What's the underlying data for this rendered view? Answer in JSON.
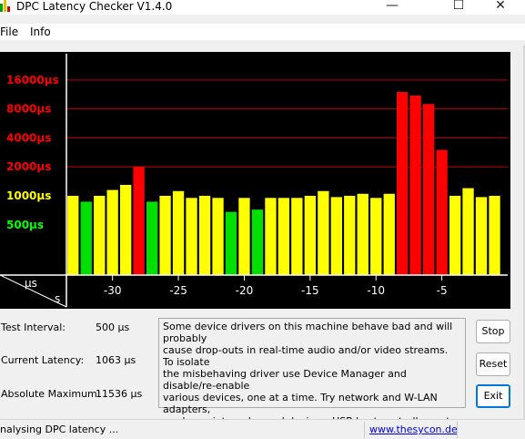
{
  "window": {
    "title": "DPC Latency Checker V1.4.0",
    "minimize_glyph": "—",
    "maximize_glyph": "☐",
    "close_glyph": "✕"
  },
  "menu": {
    "items": [
      "File",
      "Info"
    ]
  },
  "colors": {
    "chart_bg": "#000000",
    "grid_red": "#c00000",
    "label_red": "#ff0000",
    "label_yellow": "#ffff00",
    "label_green": "#00ff00",
    "bar_red": "#ff0000",
    "bar_yellow": "#ffff00",
    "bar_green": "#00e000",
    "link": "#0000ee",
    "accent": "#0078d7"
  },
  "chart_data": {
    "type": "bar",
    "y_unit_label": "µs",
    "x_unit_label": "s",
    "y_scale": "log",
    "ylim": [
      150,
      30000
    ],
    "xlim": [
      -33.5,
      0
    ],
    "gridlines": [
      2000,
      4000,
      8000,
      16000
    ],
    "y_tick_labels": [
      {
        "text": "16000µs",
        "value": 16000,
        "color": "red"
      },
      {
        "text": "8000µs",
        "value": 8000,
        "color": "red"
      },
      {
        "text": "4000µs",
        "value": 4000,
        "color": "red"
      },
      {
        "text": "2000µs",
        "value": 2000,
        "color": "red"
      },
      {
        "text": "1000µs",
        "value": 1000,
        "color": "yellow"
      },
      {
        "text": "500µs",
        "value": 500,
        "color": "green"
      }
    ],
    "x_ticks": [
      {
        "value": -30,
        "label": "-30"
      },
      {
        "value": -25,
        "label": "-25"
      },
      {
        "value": -20,
        "label": "-20"
      },
      {
        "value": -15,
        "label": "-15"
      },
      {
        "value": -10,
        "label": "-10"
      },
      {
        "value": -5,
        "label": "-5"
      }
    ],
    "x": [
      -33,
      -32,
      -31,
      -30,
      -29,
      -28,
      -27,
      -26,
      -25,
      -24,
      -23,
      -22,
      -21,
      -20,
      -19,
      -18,
      -17,
      -16,
      -15,
      -14,
      -13,
      -12,
      -11,
      -10,
      -9,
      -8,
      -7,
      -6,
      -5,
      -4,
      -3,
      -2,
      -1
    ],
    "values": [
      1000,
      870,
      1000,
      1150,
      1300,
      2000,
      870,
      1000,
      1120,
      950,
      1000,
      950,
      680,
      950,
      720,
      950,
      950,
      950,
      1000,
      1120,
      970,
      1000,
      1050,
      950,
      1050,
      12000,
      11000,
      9000,
      3000,
      1000,
      1200,
      970,
      1000
    ],
    "bar_colors": [
      "yellow",
      "green",
      "yellow",
      "yellow",
      "yellow",
      "red",
      "green",
      "yellow",
      "yellow",
      "yellow",
      "yellow",
      "yellow",
      "green",
      "yellow",
      "green",
      "yellow",
      "yellow",
      "yellow",
      "yellow",
      "yellow",
      "yellow",
      "yellow",
      "yellow",
      "yellow",
      "yellow",
      "red",
      "red",
      "red",
      "red",
      "yellow",
      "yellow",
      "yellow",
      "yellow"
    ]
  },
  "stats": [
    {
      "label": "Test Interval:",
      "value": "500 µs"
    },
    {
      "label": "Current Latency:",
      "value": "1063 µs"
    },
    {
      "label": "Absolute Maximum:",
      "value": "11536 µs"
    }
  ],
  "description": {
    "lines": [
      "Some device drivers on this machine behave bad and will probably",
      "cause drop-outs in real-time audio and/or video streams. To isolate",
      "the misbehaving driver use Device Manager and disable/re-enable",
      "various devices, one at a time. Try network and W-LAN adapters,",
      "modems, internal sound devices, USB host controllers, etc."
    ]
  },
  "buttons": {
    "stop": "Stop",
    "reset": "Reset",
    "exit": "Exit"
  },
  "status": {
    "text": "nalysing DPC latency ...",
    "link": "www.thesycon.de"
  }
}
